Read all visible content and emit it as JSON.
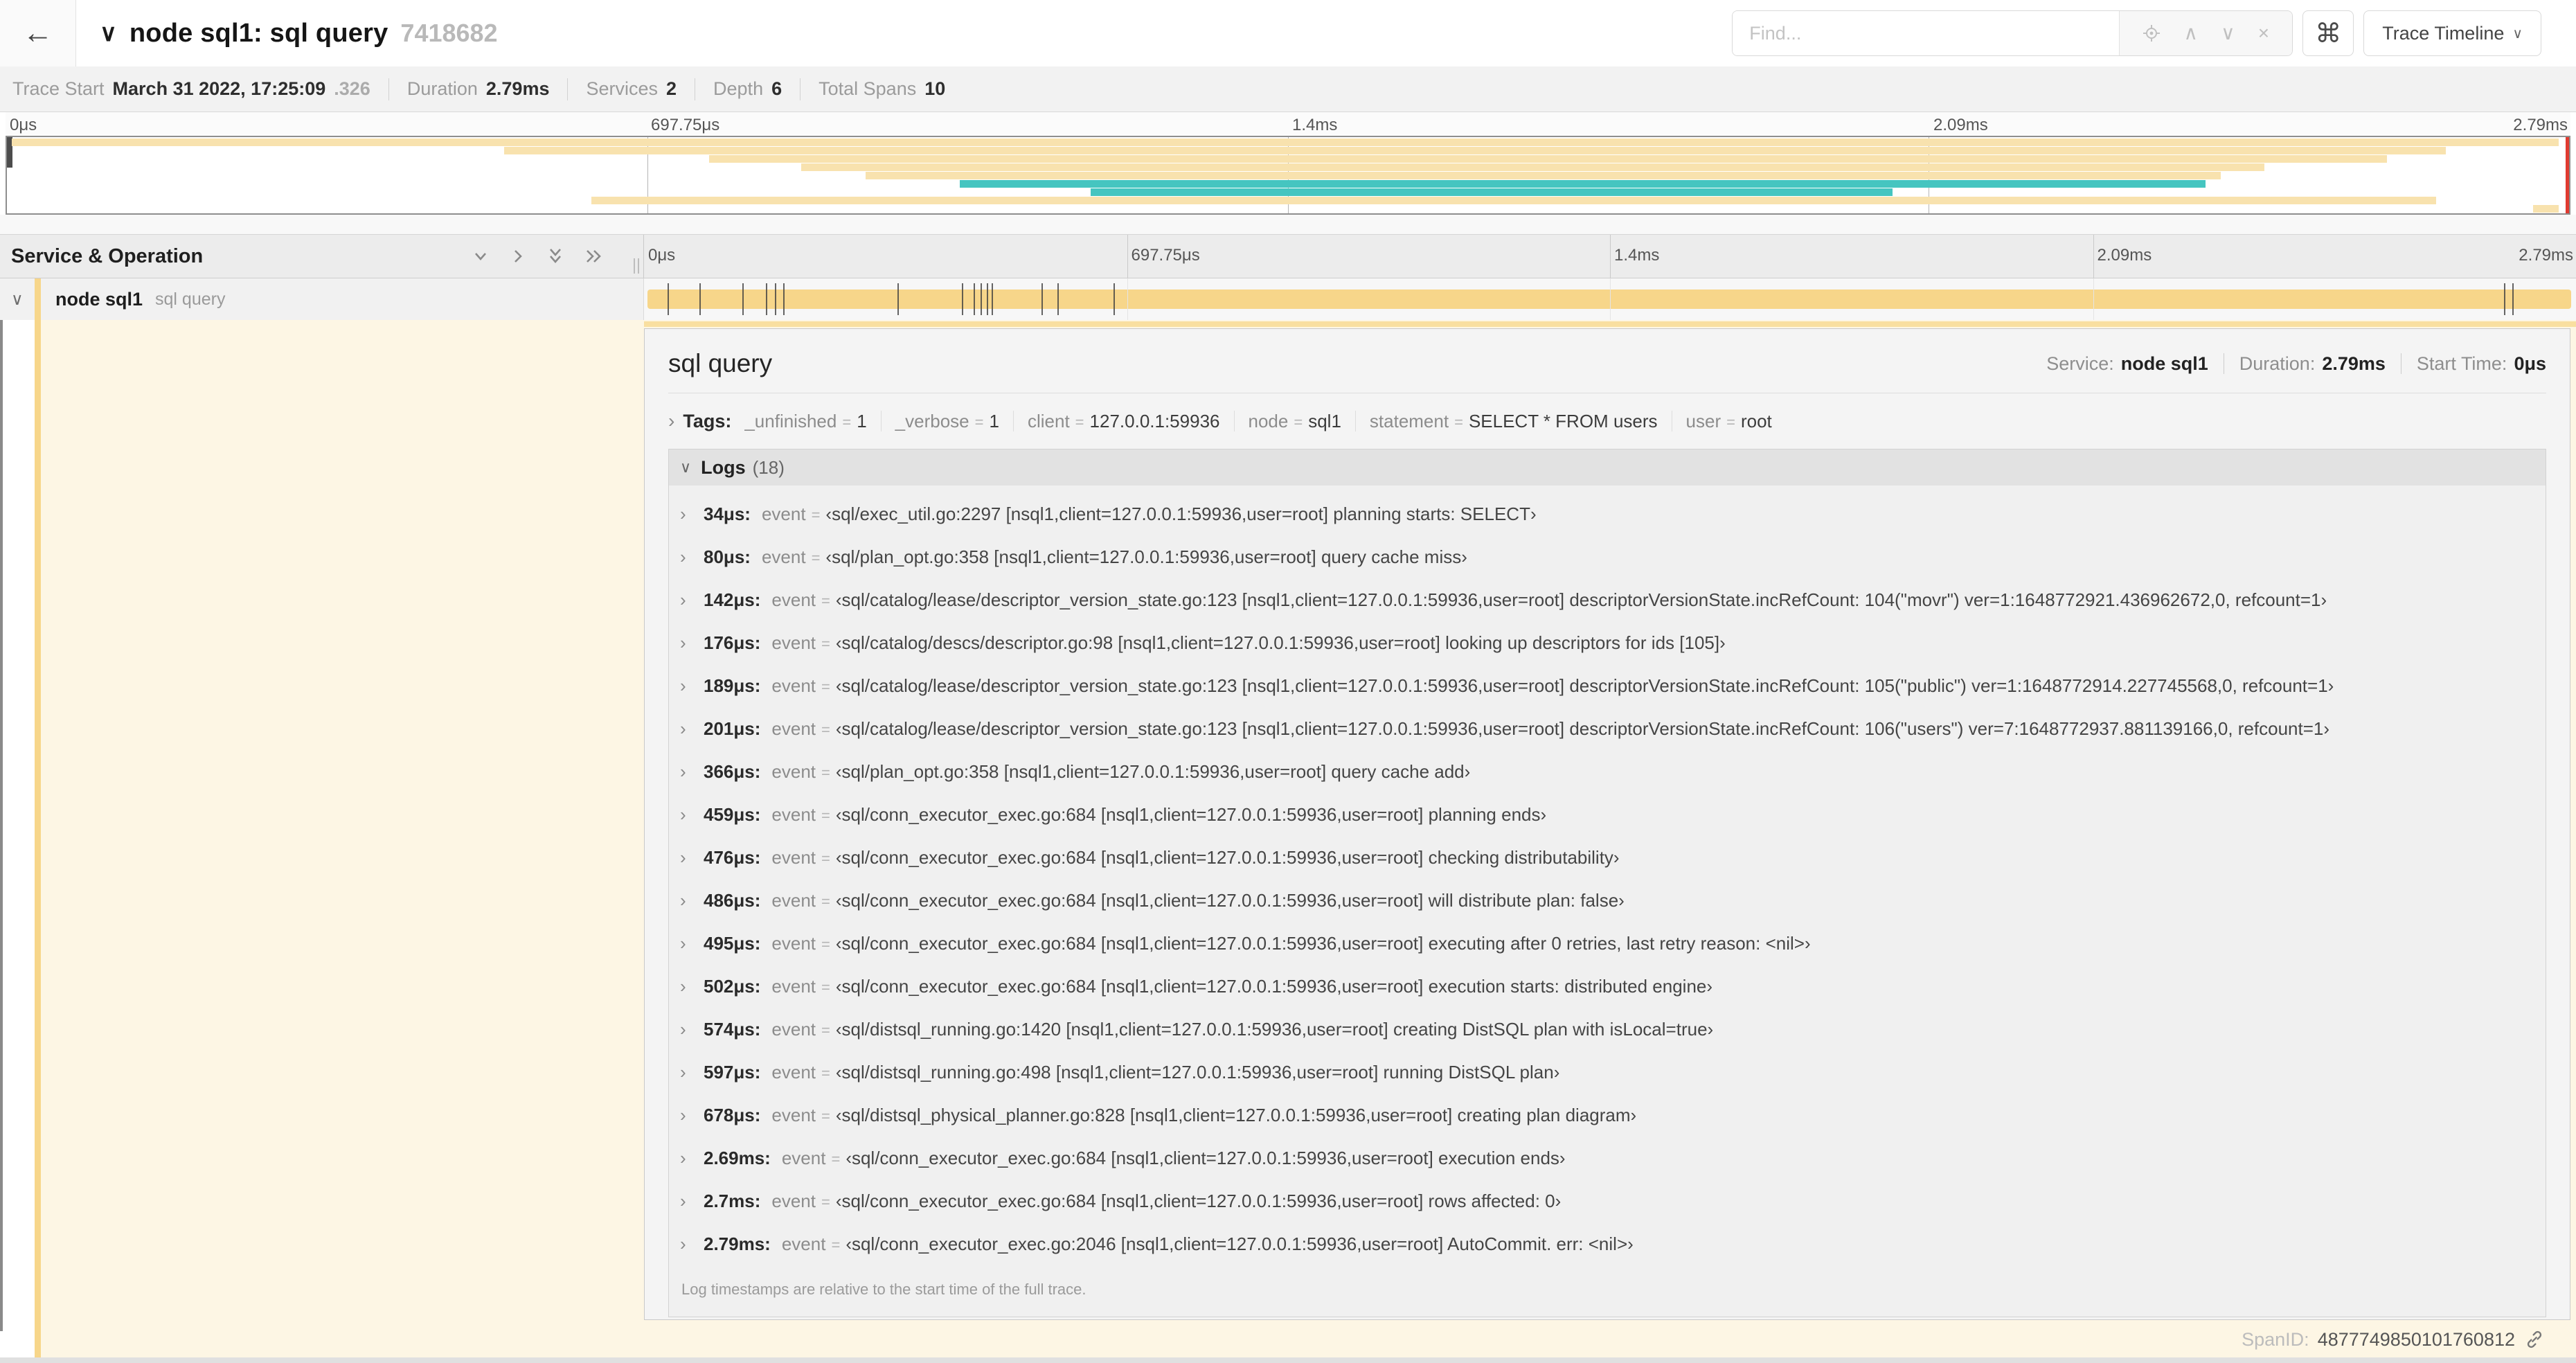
{
  "header": {
    "title": "node sql1: sql query",
    "trace_id": "7418682",
    "find_placeholder": "Find...",
    "shortcut_icon": "⌘",
    "view_selector": "Trace Timeline"
  },
  "stats": {
    "trace_start_label": "Trace Start",
    "trace_start_value": "March 31 2022, 17:25:09",
    "trace_start_frac": ".326",
    "duration_label": "Duration",
    "duration_value": "2.79ms",
    "services_label": "Services",
    "services_value": "2",
    "depth_label": "Depth",
    "depth_value": "6",
    "total_spans_label": "Total Spans",
    "total_spans_value": "10"
  },
  "colors": {
    "span_tan": "#f7d68a",
    "span_tan_light": "#f8e2ae",
    "span_tan_strip": "#f9dfa0",
    "span_teal": "#45c5c0",
    "selected_row_bg": "#fdf6e4"
  },
  "timeline": {
    "labels": [
      {
        "text": "0μs",
        "pct": 0
      },
      {
        "text": "697.75μs",
        "pct": 25
      },
      {
        "text": "1.4ms",
        "pct": 50
      },
      {
        "text": "2.09ms",
        "pct": 75
      },
      {
        "text": "2.79ms",
        "pct": 100
      }
    ],
    "duration_us": 2790,
    "minimap_bars": [
      {
        "color": "tan",
        "start": 0.2,
        "end": 99.6
      },
      {
        "color": "tan",
        "start": 19.4,
        "end": 95.2
      },
      {
        "color": "tan",
        "start": 27.4,
        "end": 92.9
      },
      {
        "color": "tan",
        "start": 31.0,
        "end": 88.1
      },
      {
        "color": "tan",
        "start": 33.5,
        "end": 86.4
      },
      {
        "color": "teal",
        "start": 37.2,
        "end": 85.8
      },
      {
        "color": "teal",
        "start": 42.3,
        "end": 73.6
      },
      {
        "color": "tan",
        "start": 22.8,
        "end": 94.8
      },
      {
        "color": "tan",
        "start": 98.6,
        "end": 99.6
      }
    ],
    "log_tick_times_us": [
      34,
      80,
      142,
      176,
      189,
      201,
      366,
      459,
      476,
      486,
      495,
      502,
      574,
      597,
      678,
      2686,
      2698
    ]
  },
  "grid": {
    "left_header": "Service & Operation",
    "row": {
      "service": "node sql1",
      "operation": "sql query"
    }
  },
  "detail": {
    "title": "sql query",
    "service_label": "Service:",
    "service_value": "node sql1",
    "duration_label": "Duration:",
    "duration_value": "2.79ms",
    "start_label": "Start Time:",
    "start_value": "0μs",
    "tags_label": "Tags:",
    "tags": [
      {
        "key": "_unfinished",
        "value": "1"
      },
      {
        "key": "_verbose",
        "value": "1"
      },
      {
        "key": "client",
        "value": "127.0.0.1:59936"
      },
      {
        "key": "node",
        "value": "sql1"
      },
      {
        "key": "statement",
        "value": "SELECT * FROM users"
      },
      {
        "key": "user",
        "value": "root"
      }
    ],
    "logs_label": "Logs",
    "logs_count": "(18)",
    "log_key": "event",
    "logs": [
      {
        "time": "34μs:",
        "value": "‹sql/exec_util.go:2297 [nsql1,client=127.0.0.1:59936,user=root] planning starts: SELECT›"
      },
      {
        "time": "80μs:",
        "value": "‹sql/plan_opt.go:358 [nsql1,client=127.0.0.1:59936,user=root] query cache miss›"
      },
      {
        "time": "142μs:",
        "value": "‹sql/catalog/lease/descriptor_version_state.go:123 [nsql1,client=127.0.0.1:59936,user=root] descriptorVersionState.incRefCount: 104(\"movr\") ver=1:1648772921.436962672,0, refcount=1›"
      },
      {
        "time": "176μs:",
        "value": "‹sql/catalog/descs/descriptor.go:98 [nsql1,client=127.0.0.1:59936,user=root] looking up descriptors for ids [105]›"
      },
      {
        "time": "189μs:",
        "value": "‹sql/catalog/lease/descriptor_version_state.go:123 [nsql1,client=127.0.0.1:59936,user=root] descriptorVersionState.incRefCount: 105(\"public\") ver=1:1648772914.227745568,0, refcount=1›"
      },
      {
        "time": "201μs:",
        "value": "‹sql/catalog/lease/descriptor_version_state.go:123 [nsql1,client=127.0.0.1:59936,user=root] descriptorVersionState.incRefCount: 106(\"users\") ver=7:1648772937.881139166,0, refcount=1›"
      },
      {
        "time": "366μs:",
        "value": "‹sql/plan_opt.go:358 [nsql1,client=127.0.0.1:59936,user=root] query cache add›"
      },
      {
        "time": "459μs:",
        "value": "‹sql/conn_executor_exec.go:684 [nsql1,client=127.0.0.1:59936,user=root] planning ends›"
      },
      {
        "time": "476μs:",
        "value": "‹sql/conn_executor_exec.go:684 [nsql1,client=127.0.0.1:59936,user=root] checking distributability›"
      },
      {
        "time": "486μs:",
        "value": "‹sql/conn_executor_exec.go:684 [nsql1,client=127.0.0.1:59936,user=root] will distribute plan: false›"
      },
      {
        "time": "495μs:",
        "value": "‹sql/conn_executor_exec.go:684 [nsql1,client=127.0.0.1:59936,user=root] executing after 0 retries, last retry reason: <nil>›"
      },
      {
        "time": "502μs:",
        "value": "‹sql/conn_executor_exec.go:684 [nsql1,client=127.0.0.1:59936,user=root] execution starts: distributed engine›"
      },
      {
        "time": "574μs:",
        "value": "‹sql/distsql_running.go:1420 [nsql1,client=127.0.0.1:59936,user=root] creating DistSQL plan with isLocal=true›"
      },
      {
        "time": "597μs:",
        "value": "‹sql/distsql_running.go:498 [nsql1,client=127.0.0.1:59936,user=root] running DistSQL plan›"
      },
      {
        "time": "678μs:",
        "value": "‹sql/distsql_physical_planner.go:828 [nsql1,client=127.0.0.1:59936,user=root] creating plan diagram›"
      },
      {
        "time": "2.69ms:",
        "value": "‹sql/conn_executor_exec.go:684 [nsql1,client=127.0.0.1:59936,user=root] execution ends›"
      },
      {
        "time": "2.7ms:",
        "value": "‹sql/conn_executor_exec.go:684 [nsql1,client=127.0.0.1:59936,user=root] rows affected: 0›"
      },
      {
        "time": "2.79ms:",
        "value": "‹sql/conn_executor_exec.go:2046 [nsql1,client=127.0.0.1:59936,user=root] AutoCommit. err: <nil>›"
      }
    ],
    "footnote": "Log timestamps are relative to the start time of the full trace.",
    "span_id_label": "SpanID:",
    "span_id": "4877749850101760812"
  }
}
